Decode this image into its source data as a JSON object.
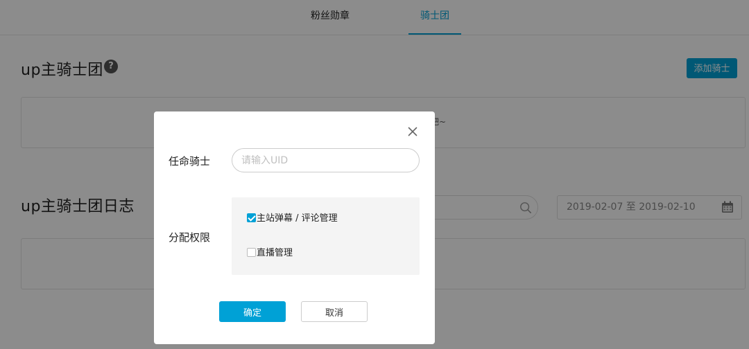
{
  "tabs": [
    {
      "label": "粉丝勋章",
      "active": false
    },
    {
      "label": "骑士团",
      "active": true
    }
  ],
  "knights": {
    "title": "up主骑士团",
    "help_icon": "help-icon",
    "add_button": "添加骑士",
    "empty_text": "吧~"
  },
  "log": {
    "title": "up主骑士团日志",
    "date_range": "2019-02-07 至 2019-02-10",
    "search_icon": "search-icon",
    "calendar_icon": "calendar-icon"
  },
  "modal": {
    "appoint_label": "任命骑士",
    "uid_placeholder": "请输入UID",
    "uid_value": "",
    "permission_label": "分配权限",
    "permissions": [
      {
        "label": "主站弹幕 / 评论管理",
        "checked": true
      },
      {
        "label": "直播管理",
        "checked": false
      }
    ],
    "confirm_button": "确定",
    "cancel_button": "取消",
    "close_icon": "close-icon"
  },
  "colors": {
    "accent": "#00a1d6",
    "overlay": "rgba(0,0,0,0.45)"
  }
}
